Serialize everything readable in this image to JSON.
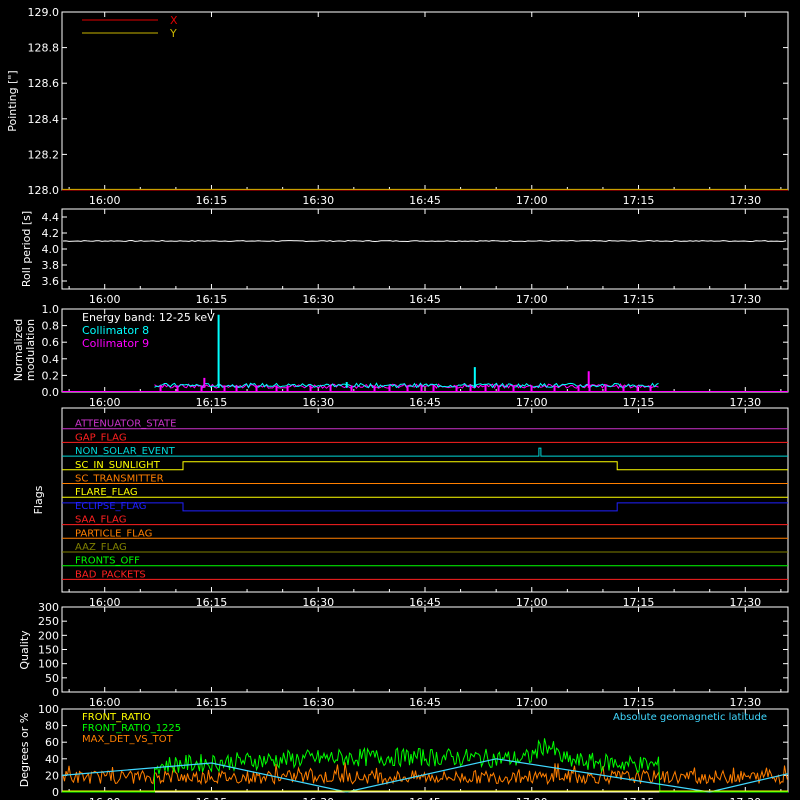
{
  "x_axis": {
    "ticks": [
      "16:00",
      "16:15",
      "16:30",
      "16:45",
      "17:00",
      "17:15",
      "17:30"
    ],
    "range": [
      "15:54",
      "17:36"
    ]
  },
  "panels": {
    "pointing": {
      "ylabel": "Pointing [\"]",
      "yticks": [
        "128.0",
        "128.2",
        "128.4",
        "128.6",
        "128.8",
        "129.0"
      ],
      "legend": [
        {
          "label": "X",
          "color": "#e00000"
        },
        {
          "label": "Y",
          "color": "#c8b400"
        }
      ]
    },
    "roll": {
      "ylabel": "Roll period [s]",
      "yticks": [
        "3.6",
        "3.8",
        "4.0",
        "4.2",
        "4.4"
      ]
    },
    "modulation": {
      "ylabel_line1": "Normalized",
      "ylabel_line2": "modulation",
      "yticks": [
        "0.0",
        "0.2",
        "0.4",
        "0.6",
        "0.8",
        "1.0"
      ],
      "legend": [
        {
          "label": "Energy band: 12-25 keV",
          "color": "#ffffff"
        },
        {
          "label": "Collimator 8",
          "color": "#00ffff"
        },
        {
          "label": "Collimator 9",
          "color": "#ff00ff"
        }
      ]
    },
    "flags": {
      "ylabel": "Flags",
      "items": [
        {
          "label": "ATTENUATOR_STATE",
          "color": "#cc33cc"
        },
        {
          "label": "GAP_FLAG",
          "color": "#ff2020"
        },
        {
          "label": "NON_SOLAR_EVENT",
          "color": "#00d8d8"
        },
        {
          "label": "SC_IN_SUNLIGHT",
          "color": "#ffff00"
        },
        {
          "label": "SC_TRANSMITTER",
          "color": "#ff7f00"
        },
        {
          "label": "FLARE_FLAG",
          "color": "#ffff00"
        },
        {
          "label": "ECLIPSE_FLAG",
          "color": "#2020ff"
        },
        {
          "label": "SAA_FLAG",
          "color": "#ff2020"
        },
        {
          "label": "PARTICLE_FLAG",
          "color": "#ff7f00"
        },
        {
          "label": "AAZ_FLAG",
          "color": "#808000"
        },
        {
          "label": "FRONTS_OFF",
          "color": "#00ff00"
        },
        {
          "label": "BAD_PACKETS",
          "color": "#ff2020"
        }
      ]
    },
    "quality": {
      "ylabel": "Quality",
      "yticks": [
        "0",
        "50",
        "100",
        "150",
        "200",
        "250",
        "300"
      ]
    },
    "bottom": {
      "ylabel": "Degrees or %",
      "yticks": [
        "0",
        "20",
        "40",
        "60",
        "80",
        "100"
      ],
      "legend": [
        {
          "label": "FRONT_RATIO",
          "color": "#ffff00"
        },
        {
          "label": "FRONT_RATIO_1225",
          "color": "#00ff00"
        },
        {
          "label": "MAX_DET_VS_TOT",
          "color": "#ff7f00"
        }
      ],
      "right_label": "Absolute geomagnetic latitude",
      "right_label_color": "#40d8ff"
    }
  },
  "chart_data": {
    "type": "line",
    "title": "",
    "x_unit": "time (HH:MM)",
    "pointing_series": [
      {
        "name": "X",
        "color": "#e00000",
        "points": [
          [
            "15:54",
            128.0
          ],
          [
            "17:36",
            128.0
          ]
        ]
      },
      {
        "name": "Y",
        "color": "#c8b400",
        "points": [
          [
            "15:54",
            128.0
          ],
          [
            "17:36",
            128.0
          ]
        ]
      }
    ],
    "roll_period": {
      "approx_value": 4.1,
      "ylim": [
        3.5,
        4.5
      ]
    },
    "modulation": {
      "ylim": [
        0,
        1.0
      ],
      "coverage": [
        "16:07",
        "17:18"
      ],
      "baseline_collimator8": 0.08,
      "baseline_collimator9": 0.07,
      "spikes_collimator8": [
        [
          "16:16",
          0.93
        ],
        [
          "16:52",
          0.3
        ],
        [
          "16:34",
          0.12
        ]
      ],
      "spikes_collimator9": [
        [
          "17:08",
          0.25
        ],
        [
          "16:14",
          0.17
        ]
      ]
    },
    "flags_transitions": {
      "NON_SOLAR_EVENT": [
        [
          "17:01",
          1
        ],
        [
          "17:01",
          0
        ]
      ],
      "SC_IN_SUNLIGHT": [
        [
          "16:11",
          1
        ],
        [
          "17:12",
          0
        ]
      ],
      "ECLIPSE_FLAG": [
        [
          "16:11",
          0
        ],
        [
          "17:12",
          1
        ]
      ]
    },
    "quality": {
      "ylim": [
        0,
        300
      ],
      "value": 0
    },
    "bottom": {
      "ylim": [
        0,
        100
      ],
      "front_ratio_1225": {
        "coverage": [
          "16:07",
          "17:18"
        ],
        "typical": 50,
        "peak": [
          "17:02",
          70
        ]
      },
      "max_det_vs_tot": {
        "typical": 18
      },
      "geomag_latitude": {
        "points": [
          [
            "15:54",
            20
          ],
          [
            "16:15",
            35
          ],
          [
            "16:34",
            0
          ],
          [
            "16:55",
            40
          ],
          [
            "17:25",
            0
          ],
          [
            "17:36",
            22
          ]
        ]
      }
    }
  }
}
